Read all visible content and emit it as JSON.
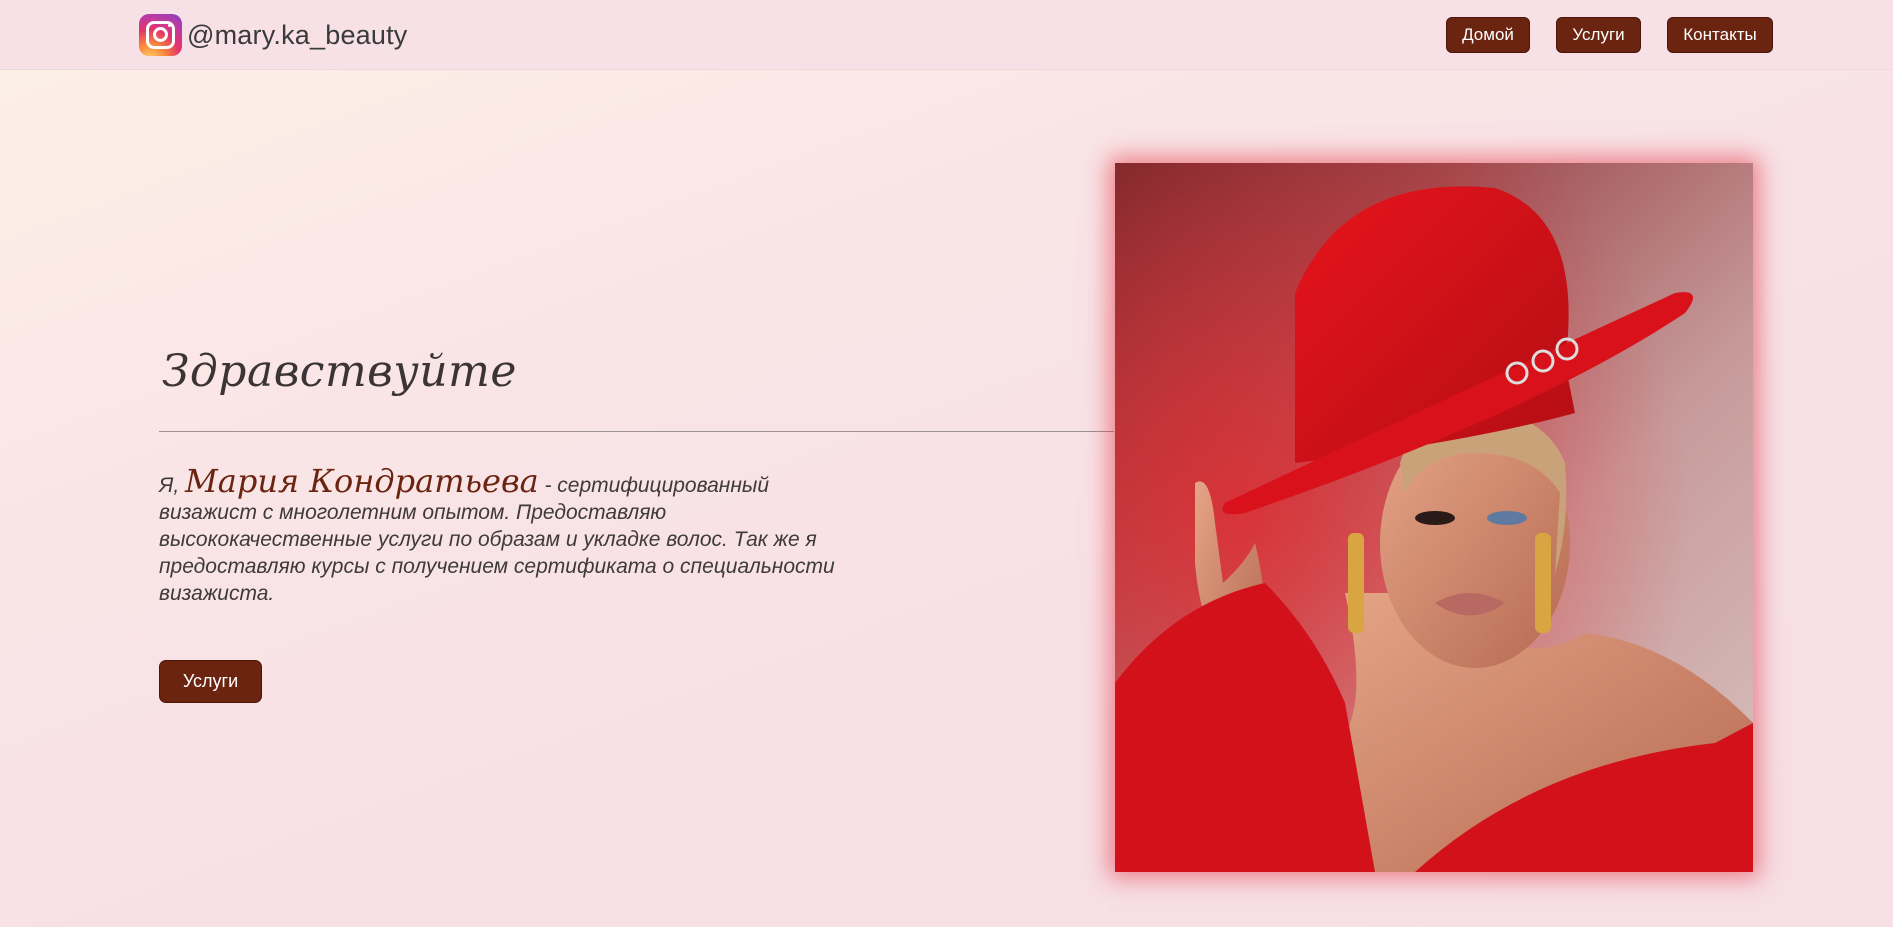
{
  "header": {
    "brand_handle": "@mary.ka_beauty",
    "brand_icon": "instagram-icon",
    "nav": [
      {
        "label": "Домой"
      },
      {
        "label": "Услуги"
      },
      {
        "label": "Контакты"
      }
    ]
  },
  "hero": {
    "greeting": "Здравствуйте",
    "intro_prefix": "Я, ",
    "intro_name": "Мария Кондратьева",
    "intro_text": " - сертифицированный визажист с многолетним опытом. Предоставляю высококачественные услуги по образам и укладке волос. Так же я предоставляю курсы с получением сертификата о специальности визажиста.",
    "cta_label": "Услуги"
  },
  "colors": {
    "accent": "#6b2410",
    "header_bg": "#f7e1e7",
    "photo_glow": "#e22d3c"
  }
}
